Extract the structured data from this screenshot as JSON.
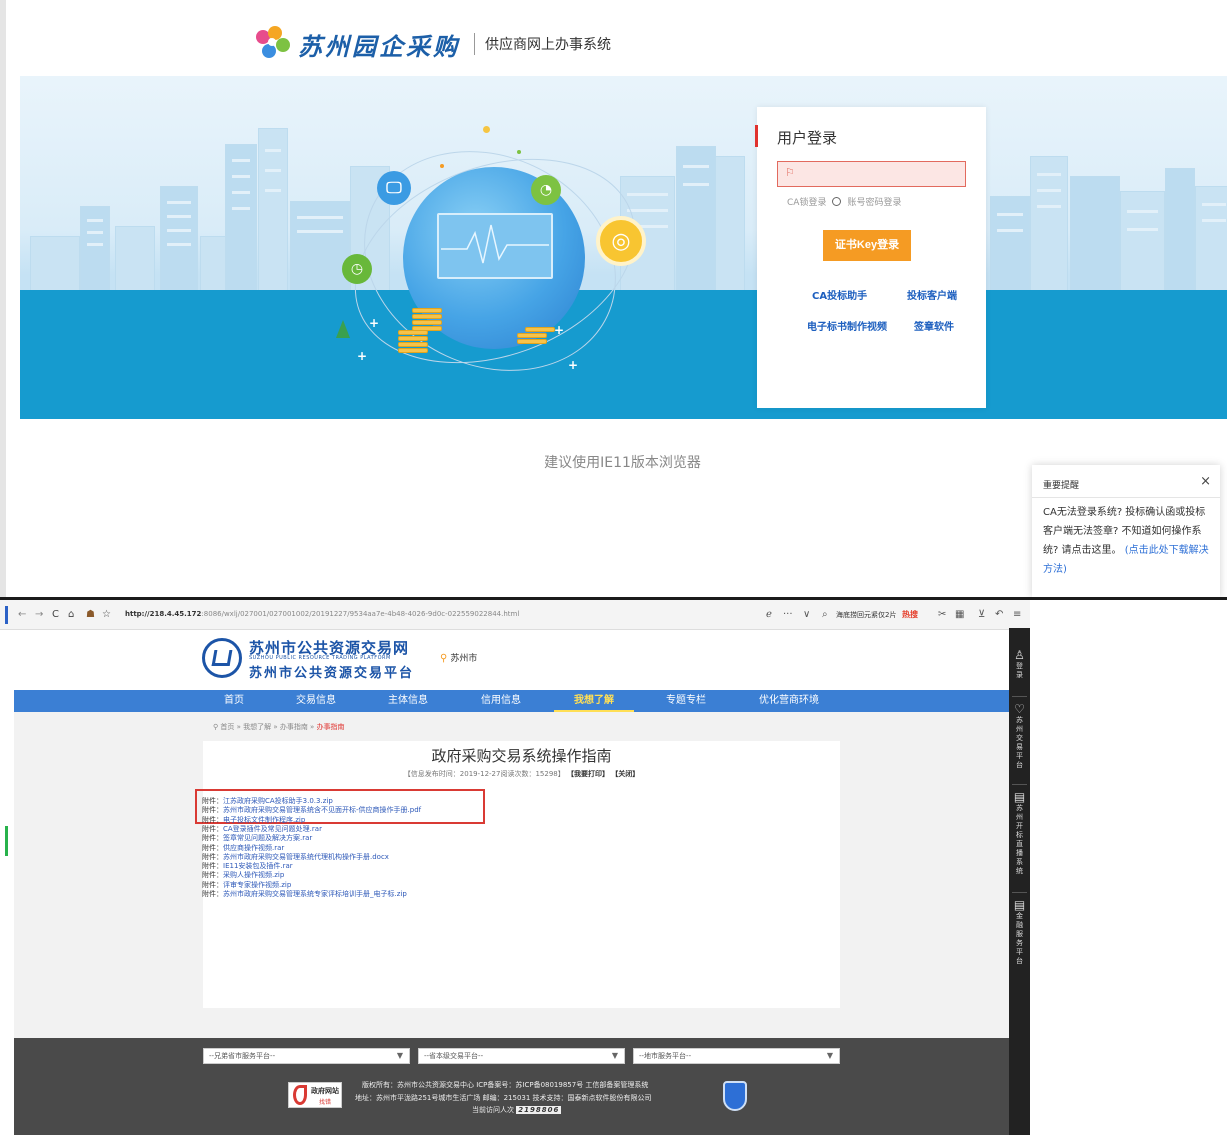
{
  "top": {
    "logo_text": "苏州园企采购",
    "logo_subtitle": "供应商网上办事系统",
    "login": {
      "title": "用户登录",
      "radio_ca": "CA锁登录",
      "radio_account": "账号密码登录",
      "submit": "证书Key登录",
      "links": [
        "CA投标助手",
        "投标客户端",
        "电子标书制作视频",
        "签章软件"
      ]
    },
    "browser_tip": "建议使用IE11版本浏览器",
    "notice": {
      "title": "重要提醒",
      "close": "×",
      "body": "CA无法登录系统? 投标确认函或投标客户端无法签章? 不知道如何操作系统? 请点击这里。",
      "link": "(点击此处下载解决方法)"
    }
  },
  "browser": {
    "nav_icons": [
      "←",
      "→",
      "C",
      "⌂",
      "☗",
      "☆"
    ],
    "url_host": "http://218.4.45.172",
    "url_path": ":8086/wxlj/027001/027001002/20191227/9534aa7e-4b48-4026-9d0c-022559022844.html",
    "search_placeholder": "海底捞回元紧仅2片",
    "hot": "热搜",
    "toolbar_icons": [
      "ℯ",
      "···",
      "∨",
      "✂",
      "▦",
      "⊻",
      "↶",
      "≡"
    ]
  },
  "site": {
    "name": "苏州市公共资源交易网",
    "name_en": "SUZHOU PUBLIC RESOURCE TRADING PLATFORM",
    "name2": "苏州市公共资源交易平台",
    "city": "苏州市",
    "nav": [
      "首页",
      "交易信息",
      "主体信息",
      "信用信息",
      "我想了解",
      "专题专栏",
      "优化营商环境"
    ],
    "active_nav": "我想了解",
    "breadcrumb": [
      "首页",
      "我想了解",
      "办事指南",
      "办事指南"
    ],
    "article": {
      "title": "政府采购交易系统操作指南",
      "meta": "【信息发布时间：2019-12-27阅读次数：15298】",
      "print": "【我要打印】",
      "close": "【关闭】",
      "attachment_label": "附件：",
      "attachments": [
        "江苏政府采购CA投标助手3.0.3.zip",
        "苏州市政府采购交易管理系统含不见面开标-供应商操作手册.pdf",
        "电子投标文件制作程序.zip",
        "CA登录插件及常见问题处理.rar",
        "签章常见问题及解决方案.rar",
        "供应商操作视频.rar",
        "苏州市政府采购交易管理系统代理机构操作手册.docx",
        "IE11安装包及插件.rar",
        "采购人操作视频.zip",
        "评审专家操作视频.zip",
        "苏州市政府采购交易管理系统专家评标培训手册_电子标.zip"
      ]
    },
    "footer": {
      "selects": [
        "--兄弟省市服务平台--",
        "--省本级交易平台--",
        "--地市服务平台--"
      ],
      "copyright": "版权所有：苏州市公共资源交易中心    ICP备案号：苏ICP备08019857号    工信部备案管理系统",
      "address": "地址：苏州市平泷路251号城市生活广场    邮编：215031    技术支持：国泰新点软件股份有限公司",
      "visits_label": "当前访问人次",
      "visits": "2198806",
      "gov_badge": "政府网站",
      "gov_badge2": "找错"
    },
    "side": [
      {
        "icon": "♙",
        "text": "登录"
      },
      {
        "icon": "♡",
        "text": "苏州交易平台"
      },
      {
        "icon": "▤",
        "text": "苏州开标直播系统"
      },
      {
        "icon": "▤",
        "text": "金融服务平台"
      }
    ]
  }
}
